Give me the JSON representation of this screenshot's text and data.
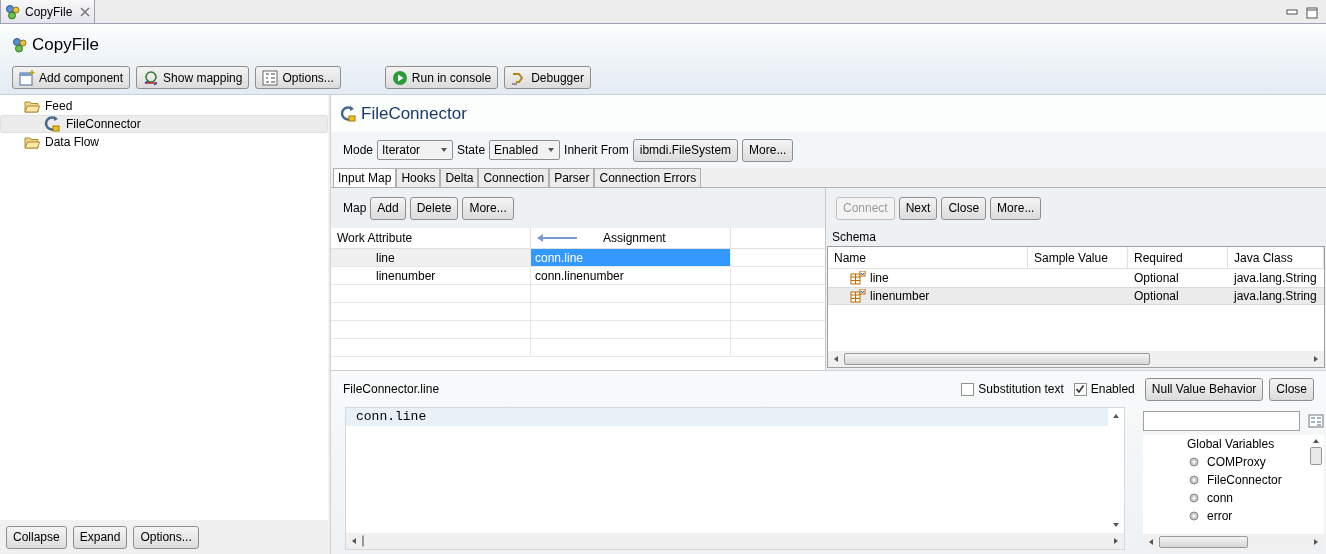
{
  "tab": {
    "title": "CopyFile"
  },
  "title": "CopyFile",
  "toolbar_groups": [
    [
      {
        "label": "Add component",
        "kind": "add"
      },
      {
        "label": "Show mapping",
        "kind": "mapping"
      },
      {
        "label": "Options...",
        "kind": "options"
      }
    ],
    [
      {
        "label": "Run in console",
        "kind": "run"
      },
      {
        "label": "Debugger",
        "kind": "debug"
      }
    ]
  ],
  "tree": [
    {
      "label": "Feed",
      "selected": false,
      "children": [
        {
          "label": "FileConnector",
          "selected": true
        }
      ]
    },
    {
      "label": "Data Flow",
      "selected": false
    }
  ],
  "tree_buttons": [
    "Collapse",
    "Expand",
    "Options..."
  ],
  "component": {
    "title": "FileConnector",
    "mode_label": "Mode",
    "mode": "Iterator",
    "state_label": "State",
    "state": "Enabled",
    "inherit_label": "Inherit From",
    "inherit": "ibmdi.FileSystem",
    "more": "More..."
  },
  "tabs": [
    {
      "label": "Input Map",
      "selected": true
    },
    {
      "label": "Hooks",
      "selected": false
    },
    {
      "label": "Delta",
      "selected": false
    },
    {
      "label": "Connection",
      "selected": false
    },
    {
      "label": "Parser",
      "selected": false
    },
    {
      "label": "Connection Errors",
      "selected": false
    }
  ],
  "map": {
    "label": "Map",
    "buttons": [
      "Add",
      "Delete",
      "More..."
    ],
    "columns": [
      "Work Attribute",
      "Assignment"
    ],
    "rows": [
      {
        "attribute": "line",
        "assignment": "conn.line",
        "selected": true
      },
      {
        "attribute": "linenumber",
        "assignment": "conn.linenumber",
        "selected": false
      }
    ]
  },
  "connector_buttons": [
    {
      "label": "Connect",
      "disabled": true
    },
    {
      "label": "Next",
      "disabled": false
    },
    {
      "label": "Close",
      "disabled": false
    },
    {
      "label": "More...",
      "disabled": false
    }
  ],
  "schema": {
    "title": "Schema",
    "columns": [
      "Name",
      "Sample Value",
      "Required",
      "Java Class"
    ],
    "rows": [
      {
        "name": "line",
        "required": "Optional",
        "java_class": "java.lang.String",
        "selected": false
      },
      {
        "name": "linenumber",
        "required": "Optional",
        "java_class": "java.lang.String",
        "selected": true
      }
    ]
  },
  "editor": {
    "label": "FileConnector.line",
    "options": [
      {
        "label": "Substitution text",
        "checked": false
      },
      {
        "label": "Enabled",
        "checked": true
      }
    ],
    "buttons": [
      "Null Value Behavior",
      "Close"
    ],
    "code": "conn.line"
  },
  "variables": {
    "heading": "Global Variables",
    "items": [
      "COMProxy",
      "FileConnector",
      "conn",
      "error"
    ]
  }
}
